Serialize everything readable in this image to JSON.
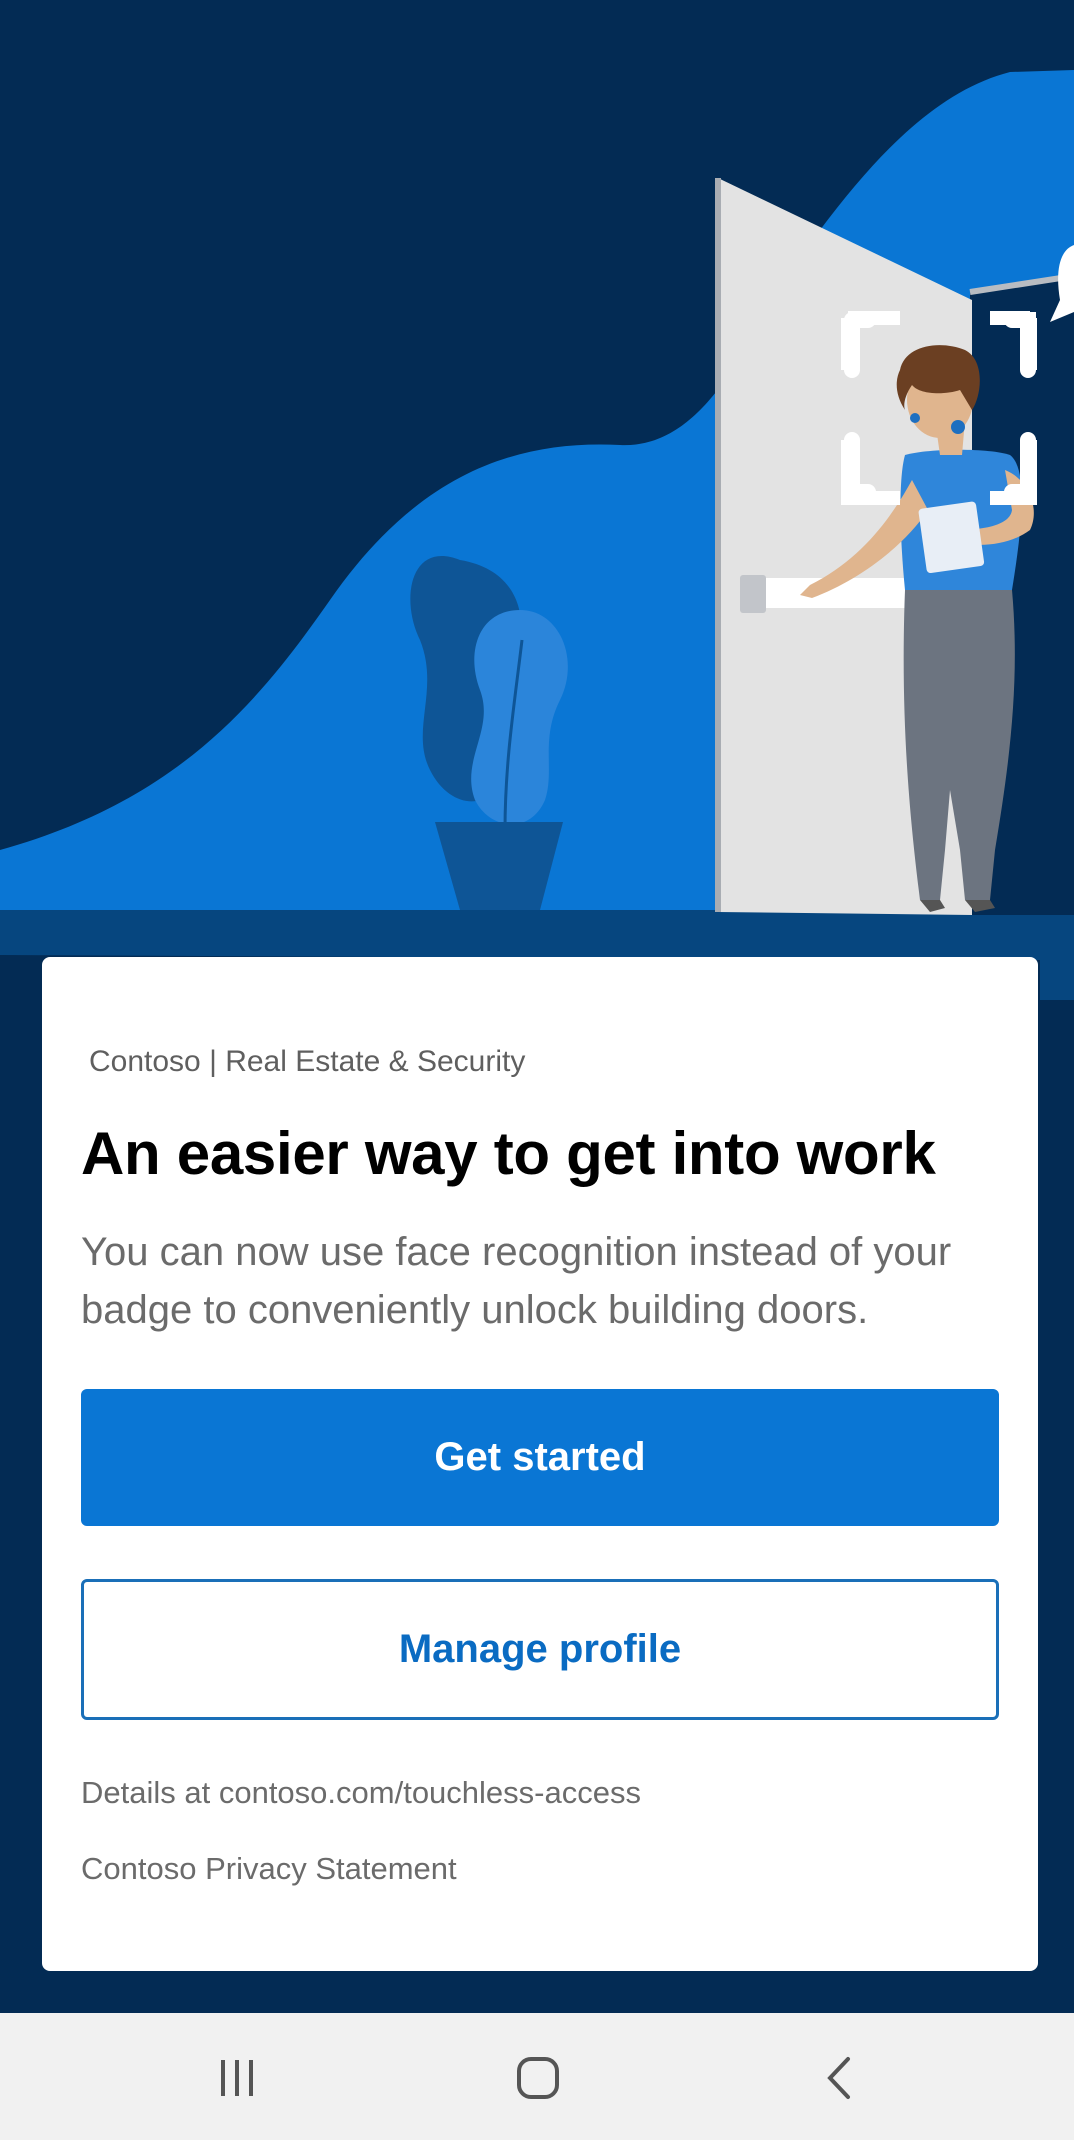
{
  "hero": {
    "illustration": "woman-at-door-face-recognition",
    "colors": {
      "background": "#032B54",
      "wave": "#0A76D4",
      "floor": "#06467F",
      "door": "#E3E3E3",
      "plant": "#1E5FA0"
    }
  },
  "card": {
    "org_label": "Contoso | Real Estate & Security",
    "headline": "An easier way to get into work",
    "description": "You can now use face recognition instead of your badge to conveniently unlock building doors.",
    "primary_button": "Get started",
    "secondary_button": "Manage profile",
    "details_link": "Details at contoso.com/touchless-access",
    "privacy_link": "Contoso Privacy Statement"
  },
  "navbar": {
    "recents_icon": "recents-icon",
    "home_icon": "home-icon",
    "back_icon": "back-icon"
  },
  "colors": {
    "accent": "#0A76D4",
    "accent_text": "#0A6BC2",
    "background": "#032B54"
  }
}
